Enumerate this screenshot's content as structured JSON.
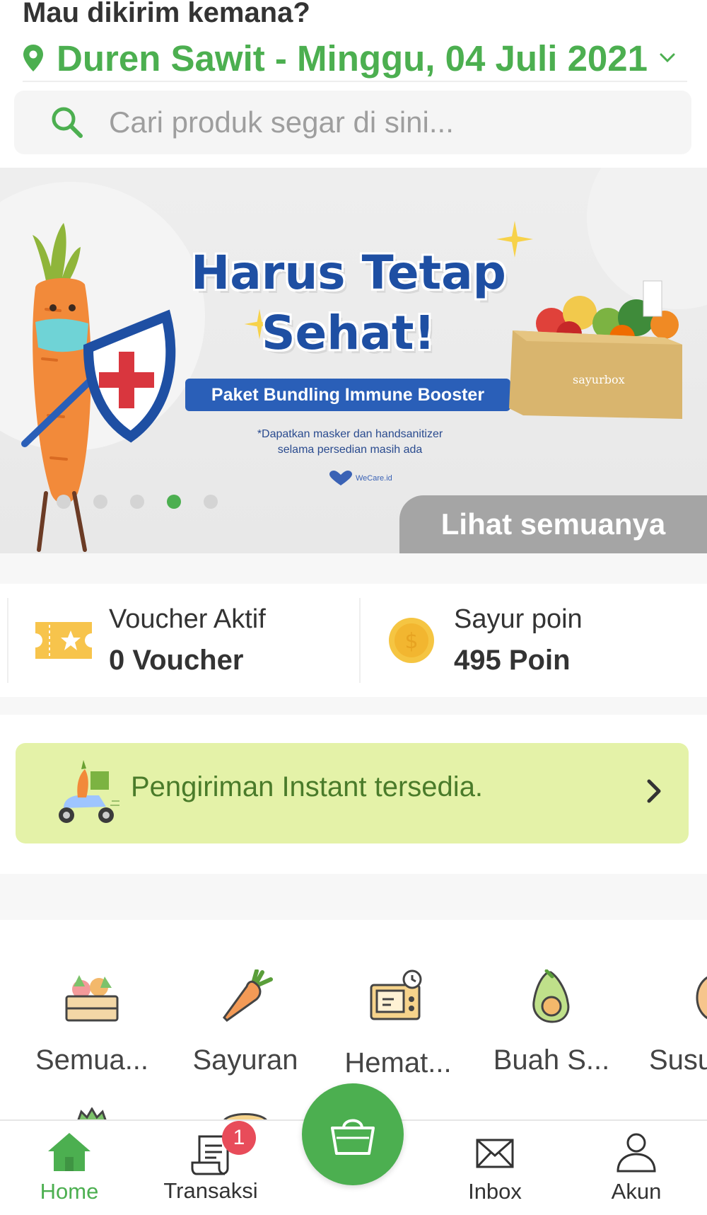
{
  "header": {
    "question": "Mau dikirim kemana?",
    "location": "Duren Sawit - Minggu, 04 Juli 2021"
  },
  "search": {
    "placeholder": "Cari produk segar di sini..."
  },
  "banner": {
    "title_line1": "Harus Tetap",
    "title_line2": "Sehat!",
    "pill": "Paket Bundling Immune Booster",
    "note_line1": "*Dapatkan masker dan handsanitizer",
    "note_line2": "selama persedian masih ada",
    "logo_text": "WeCare.id",
    "box_text": "sayurbox",
    "slides_total": 5,
    "active_slide": 4,
    "see_all": "Lihat semuanya"
  },
  "voucher": {
    "label": "Voucher Aktif",
    "value": "0 Voucher"
  },
  "points": {
    "label": "Sayur poin",
    "value": "495 Poin"
  },
  "instant": {
    "text": "Pengiriman Instant tersedia."
  },
  "categories": [
    {
      "label": "Semua...",
      "icon": "produce-crate-icon"
    },
    {
      "label": "Sayuran",
      "icon": "carrot-icon"
    },
    {
      "label": "Hemat...",
      "icon": "microwave-timer-icon"
    },
    {
      "label": "Buah S...",
      "icon": "avocado-icon"
    },
    {
      "label": "Susu",
      "icon": "egg-icon"
    }
  ],
  "nav": {
    "home": "Home",
    "transaksi": "Transaksi",
    "transaksi_badge": "1",
    "inbox": "Inbox",
    "akun": "Akun"
  },
  "colors": {
    "brand_green": "#4caf50",
    "banner_blue": "#1e4fa3",
    "instant_bg": "#e4f2a8",
    "badge_red": "#e84c5a"
  }
}
